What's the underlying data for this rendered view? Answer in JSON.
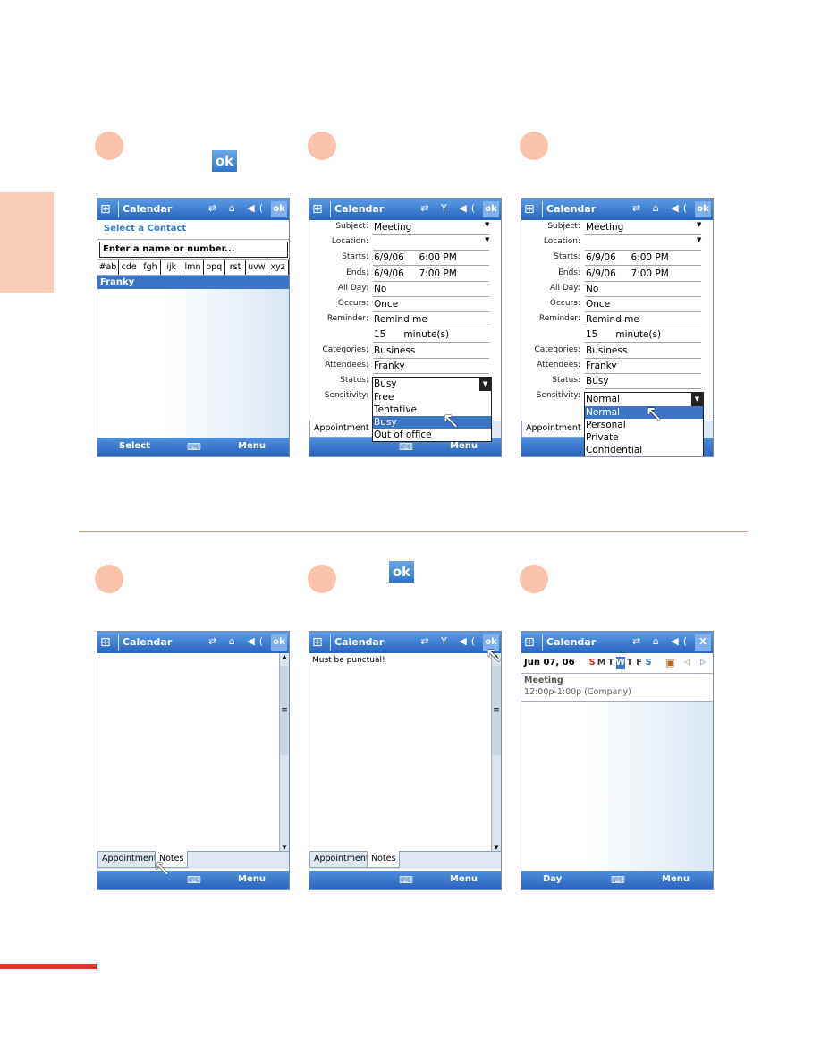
{
  "decor": {
    "accent": "#f9c4ab",
    "divider": "#f0a88a",
    "red_bar": "#e2302a",
    "titlebar": "#2965c0",
    "ok_glyph": "ok"
  },
  "screens": [
    {
      "title": "Calendar",
      "ok": "ok",
      "header": "Select a Contact",
      "input_placeholder": "Enter a name or number...",
      "letters": [
        "#ab",
        "cde",
        "fgh",
        "ijk",
        "lmn",
        "opq",
        "rst",
        "uvw",
        "xyz"
      ],
      "selected_contact": "Franky",
      "bottom": {
        "left": "Select",
        "right": "Menu"
      }
    },
    {
      "title": "Calendar",
      "ok": "ok",
      "fields": [
        {
          "label": "Subject:",
          "value": "Meeting"
        },
        {
          "label": "Location:",
          "value": ""
        },
        {
          "label": "Starts:",
          "value": "6/9/06     6:00 PM"
        },
        {
          "label": "Ends:",
          "value": "6/9/06     7:00 PM"
        },
        {
          "label": "All Day:",
          "value": "No"
        },
        {
          "label": "Occurs:",
          "value": "Once"
        },
        {
          "label": "Reminder:",
          "value": "Remind me"
        },
        {
          "label": "",
          "value": "15      minute(s)"
        },
        {
          "label": "Categories:",
          "value": "Business"
        },
        {
          "label": "Attendees:",
          "value": "Franky"
        },
        {
          "label": "Status:",
          "value": "Busy"
        },
        {
          "label": "Sensitivity:",
          "value": ""
        }
      ],
      "dropdown": {
        "selected": "Busy",
        "options": [
          "Free",
          "Tentative",
          "Busy",
          "Out of office"
        ],
        "highlighted": 2
      },
      "tab": "Appointment",
      "bottom": {
        "right": "Menu"
      }
    },
    {
      "title": "Calendar",
      "ok": "ok",
      "fields": [
        {
          "label": "Subject:",
          "value": "Meeting"
        },
        {
          "label": "Location:",
          "value": ""
        },
        {
          "label": "Starts:",
          "value": "6/9/06     6:00 PM"
        },
        {
          "label": "Ends:",
          "value": "6/9/06     7:00 PM"
        },
        {
          "label": "All Day:",
          "value": "No"
        },
        {
          "label": "Occurs:",
          "value": "Once"
        },
        {
          "label": "Reminder:",
          "value": "Remind me"
        },
        {
          "label": "",
          "value": "15      minute(s)"
        },
        {
          "label": "Categories:",
          "value": "Business"
        },
        {
          "label": "Attendees:",
          "value": "Franky"
        },
        {
          "label": "Status:",
          "value": "Busy"
        },
        {
          "label": "Sensitivity:",
          "value": ""
        }
      ],
      "dropdown": {
        "selected": "Normal",
        "options": [
          "Normal",
          "Personal",
          "Private",
          "Confidential"
        ],
        "highlighted": 0
      },
      "tab": "Appointment",
      "bottom": {
        "right": "Menu"
      }
    },
    {
      "title": "Calendar",
      "ok": "ok",
      "note": "",
      "tabs": [
        "Appointment",
        "Notes"
      ],
      "active_tab": 1,
      "bottom": {
        "right": "Menu"
      }
    },
    {
      "title": "Calendar",
      "ok": "ok",
      "note": "Must be punctual!",
      "tabs": [
        "Appointment",
        "Notes"
      ],
      "active_tab": 1,
      "bottom": {
        "right": "Menu"
      }
    },
    {
      "title": "Calendar",
      "close": "X",
      "date": "Jun 07, 06",
      "days": [
        "S",
        "M",
        "T",
        "W",
        "T",
        "F",
        "S"
      ],
      "today_index": 3,
      "event_title": "Meeting",
      "event_time": "12:00p-1:00p (Company)",
      "bottom": {
        "left": "Day",
        "right": "Menu"
      }
    }
  ]
}
